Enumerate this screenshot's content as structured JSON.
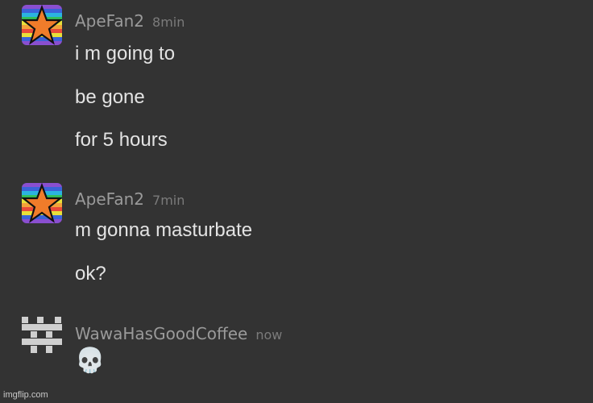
{
  "messages": [
    {
      "username": "ApeFan2",
      "timestamp": "8min",
      "avatar_icon": "rainbow-star-icon",
      "lines": [
        "i m going to",
        "be gone",
        "for 5 hours"
      ]
    },
    {
      "username": "ApeFan2",
      "timestamp": "7min",
      "avatar_icon": "rainbow-star-icon",
      "lines": [
        "m gonna masturbate",
        "ok?"
      ]
    },
    {
      "username": "WawaHasGoodCoffee",
      "timestamp": "now",
      "avatar_icon": "pixel-glyph-icon",
      "lines": [
        "💀"
      ]
    }
  ],
  "watermark": "imgflip.com",
  "colors": {
    "background": "#333333",
    "username": "#9a9a9a",
    "timestamp": "#7b7b7b",
    "message_text": "#e3e3e3"
  }
}
